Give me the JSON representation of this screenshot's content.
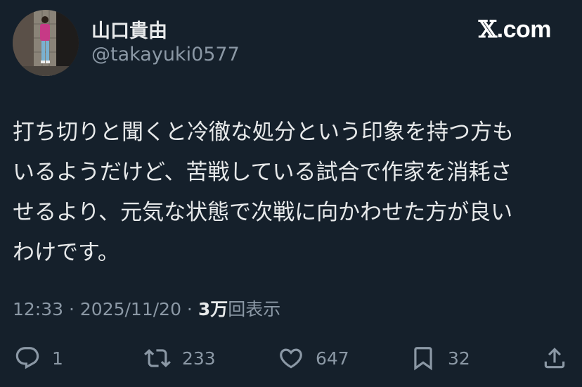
{
  "author": {
    "name": "山口貴由",
    "handle": "@takayuki0577"
  },
  "brand": {
    "mark": "𝕏",
    "text": ".com"
  },
  "tweet": {
    "lines": [
      "打ち切りと聞くと冷徹な処分という印象を持つ方も",
      "いるようだけど、苦戦している試合で作家を消耗さ",
      "せるより、元気な状態で次戦に向かわせた方が良い",
      "わけです。"
    ]
  },
  "meta": {
    "time": "12:33",
    "separator": " · ",
    "date": "2025/11/20",
    "views_count": "3万",
    "views_label": "回表示"
  },
  "actions": {
    "reply": {
      "icon": "reply-icon",
      "count": "1"
    },
    "retweet": {
      "icon": "retweet-icon",
      "count": "233"
    },
    "like": {
      "icon": "heart-icon",
      "count": "647"
    },
    "bookmark": {
      "icon": "bookmark-icon",
      "count": "32"
    },
    "share": {
      "icon": "share-icon"
    }
  },
  "colors": {
    "background": "#15202b",
    "text_primary": "#e7e9ea",
    "text_secondary": "#8b98a5"
  }
}
